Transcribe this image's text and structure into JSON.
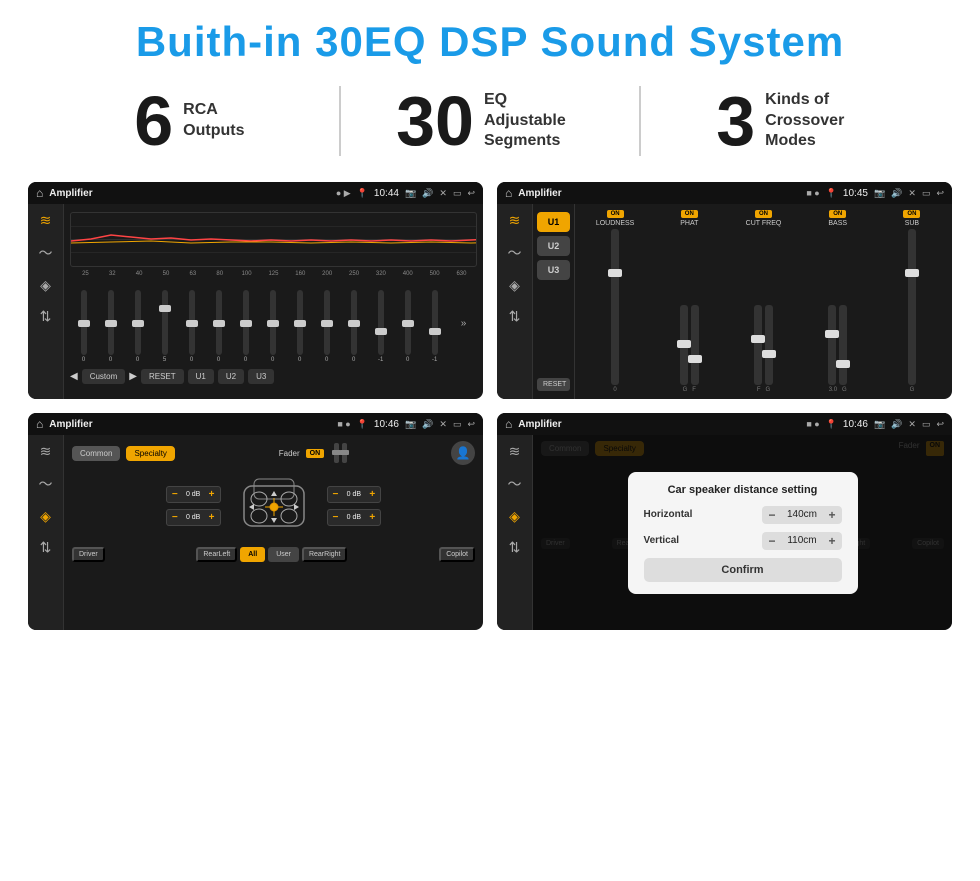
{
  "header": {
    "title": "Buith-in 30EQ DSP Sound System"
  },
  "stats": [
    {
      "number": "6",
      "label": "RCA\nOutputs"
    },
    {
      "number": "30",
      "label": "EQ Adjustable\nSegments"
    },
    {
      "number": "3",
      "label": "Kinds of\nCrossover Modes"
    }
  ],
  "screens": [
    {
      "id": "screen1",
      "title": "Amplifier",
      "time": "10:44",
      "type": "eq",
      "eq_preset": "Custom",
      "eq_labels": [
        "25",
        "32",
        "40",
        "50",
        "63",
        "80",
        "100",
        "125",
        "160",
        "200",
        "250",
        "320",
        "400",
        "500",
        "630"
      ],
      "eq_values": [
        "0",
        "0",
        "0",
        "5",
        "0",
        "0",
        "0",
        "0",
        "0",
        "0",
        "0",
        "-1",
        "0",
        "-1"
      ],
      "buttons": [
        "RESET",
        "U1",
        "U2",
        "U3"
      ]
    },
    {
      "id": "screen2",
      "title": "Amplifier",
      "time": "10:45",
      "type": "eq2",
      "channels": [
        {
          "id": "U1",
          "active": true
        },
        {
          "id": "U2",
          "active": false
        },
        {
          "id": "U3",
          "active": false
        }
      ],
      "eq2_channels": [
        "LOUDNESS",
        "PHAT",
        "CUT FREQ",
        "BASS",
        "SUB"
      ]
    },
    {
      "id": "screen3",
      "title": "Amplifier",
      "time": "10:46",
      "type": "fader",
      "tab_common": "Common",
      "tab_specialty": "Specialty",
      "active_tab": "Specialty",
      "fader_label": "Fader",
      "fader_on": "ON",
      "volumes": [
        "0 dB",
        "0 dB",
        "0 dB",
        "0 dB"
      ],
      "buttons": [
        "Driver",
        "Copilot",
        "RearLeft",
        "All",
        "User",
        "RearRight"
      ]
    },
    {
      "id": "screen4",
      "title": "Amplifier",
      "time": "10:46",
      "type": "dialog",
      "dialog_title": "Car speaker distance setting",
      "dialog_fields": [
        {
          "label": "Horizontal",
          "value": "140cm"
        },
        {
          "label": "Vertical",
          "value": "110cm"
        }
      ],
      "confirm_label": "Confirm",
      "tab_common": "Common",
      "tab_specialty": "Specialty"
    }
  ],
  "icons": {
    "home": "⌂",
    "music": "♪",
    "wave": "〜",
    "speaker": "◈",
    "expand": "»",
    "back": "↩",
    "play": "▶",
    "pause": "◀",
    "volume": "🔊",
    "settings": "⚙",
    "person": "👤",
    "location": "📍",
    "camera": "📷",
    "eq_icon": "≋",
    "sliders": "⊟",
    "arrows": "⇅",
    "filter": "⊞"
  }
}
